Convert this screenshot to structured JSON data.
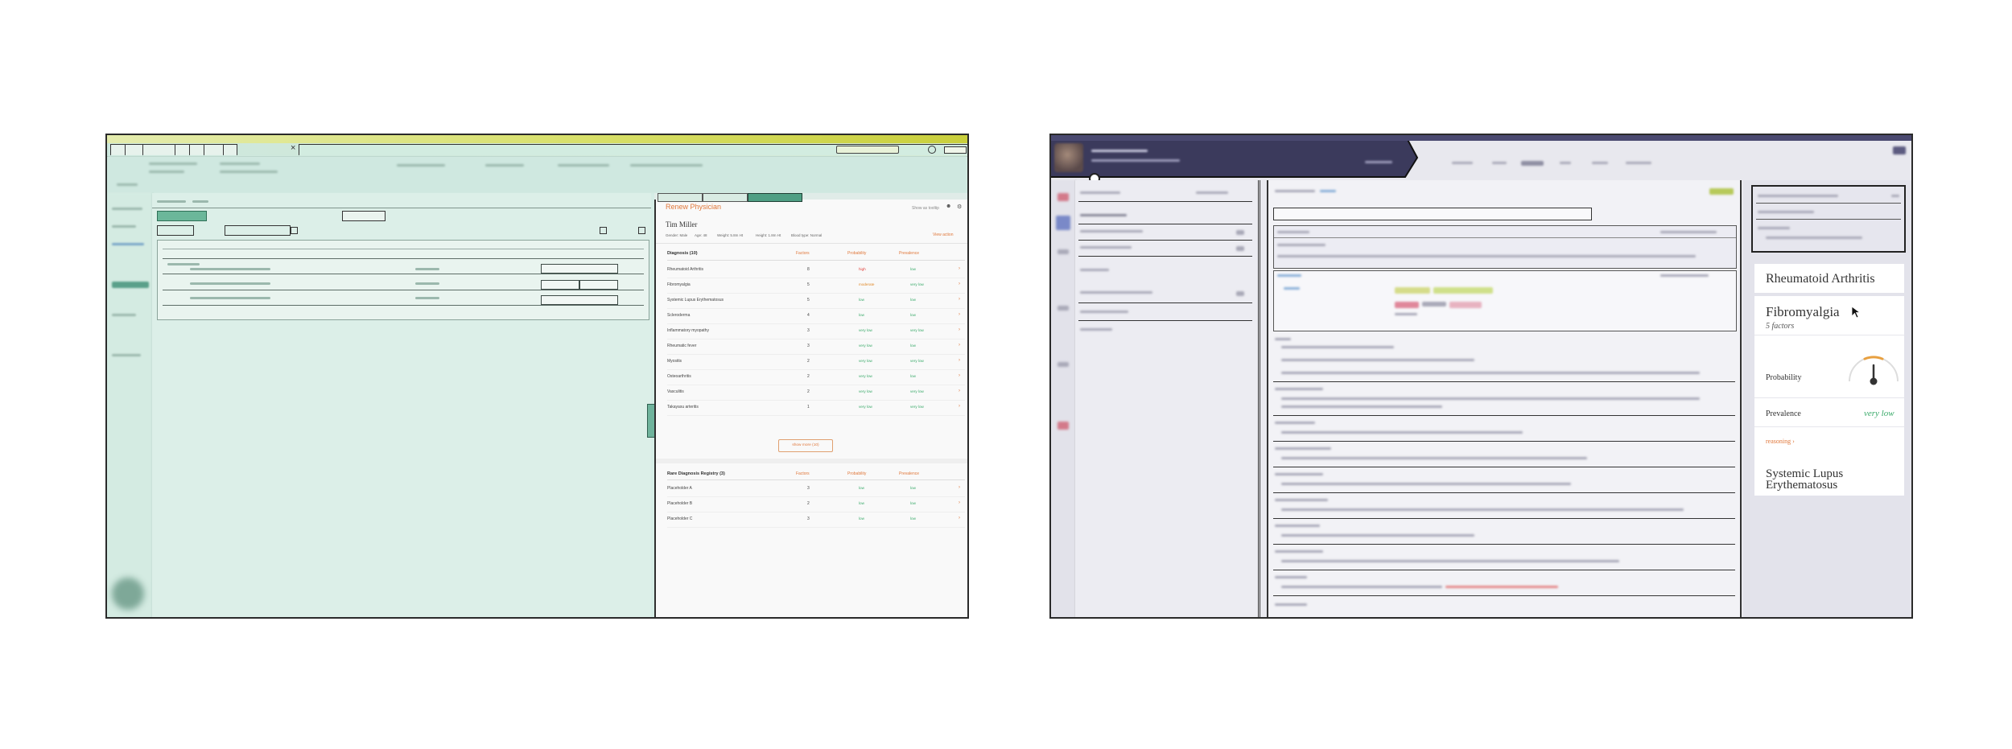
{
  "left_screen": {
    "panel": {
      "title": "Renew Physician",
      "header_link": "Show as tooltip",
      "patient_name": "Tim Miller",
      "meta": [
        "Gender: Male",
        "Age: 48",
        "Weight: 5.8m Ht",
        "Height: 1.8m Ht",
        "Blood type: Normal"
      ],
      "view_action": "View action",
      "diagnosis_header": "Diagnosis (10)",
      "columns": {
        "factors": "Factors",
        "probability": "Probability",
        "prevalence": "Prevalence"
      },
      "diagnoses": [
        {
          "name": "Rheumatoid Arthritis",
          "factors": "8",
          "probability": "high",
          "prevalence": "low"
        },
        {
          "name": "Fibromyalgia",
          "factors": "5",
          "probability": "moderate",
          "prevalence": "very low"
        },
        {
          "name": "Systemic Lupus Erythematosus",
          "factors": "5",
          "probability": "low",
          "prevalence": "low"
        },
        {
          "name": "Scleroderma",
          "factors": "4",
          "probability": "low",
          "prevalence": "low"
        },
        {
          "name": "Inflammatory myopathy",
          "factors": "3",
          "probability": "very low",
          "prevalence": "very low"
        },
        {
          "name": "Rheumatic fever",
          "factors": "3",
          "probability": "very low",
          "prevalence": "low"
        },
        {
          "name": "Myositis",
          "factors": "2",
          "probability": "very low",
          "prevalence": "very low"
        },
        {
          "name": "Osteoarthritis",
          "factors": "2",
          "probability": "very low",
          "prevalence": "low"
        },
        {
          "name": "Vasculitis",
          "factors": "2",
          "probability": "very low",
          "prevalence": "very low"
        },
        {
          "name": "Takayasu arteritis",
          "factors": "1",
          "probability": "very low",
          "prevalence": "very low"
        }
      ],
      "show_more": "show more (10)",
      "rare_header": "Rare Diagnosis Registry (3)",
      "rare": [
        {
          "name": "Placeholder A",
          "factors": "3",
          "probability": "low",
          "prevalence": "low"
        },
        {
          "name": "Placeholder B",
          "factors": "2",
          "probability": "low",
          "prevalence": "low"
        },
        {
          "name": "Placeholder C",
          "factors": "3",
          "probability": "low",
          "prevalence": "low"
        }
      ]
    }
  },
  "right_screen": {
    "panel": {
      "card_1_title": "Rheumatoid Arthritis",
      "card_2_title": "Fibromyalgia",
      "card_2_factors": "5 factors",
      "probability_label": "Probability",
      "probability_level": 0.5,
      "prevalence_label": "Prevalence",
      "prevalence_value": "very low",
      "reasoning_link": "reasoning",
      "card_3_title": "Systemic Lupus Erythematosus"
    }
  },
  "colors": {
    "accent_orange": "#e0773a",
    "low_green": "#3aaa6a",
    "high_red": "#e0403a",
    "nav_dark": "#3b3a5c",
    "left_tint": "#d6ede6"
  }
}
